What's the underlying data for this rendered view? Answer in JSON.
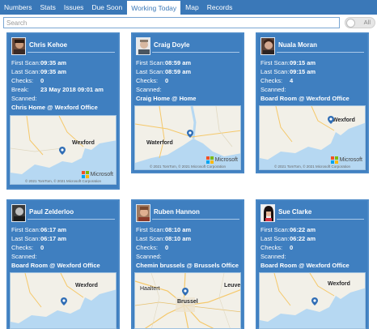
{
  "tabs": [
    {
      "label": "Numbers"
    },
    {
      "label": "Stats"
    },
    {
      "label": "Issues"
    },
    {
      "label": "Due Soon"
    },
    {
      "label": "Working Today",
      "active": true
    },
    {
      "label": "Map"
    },
    {
      "label": "Records"
    }
  ],
  "search": {
    "placeholder": "Search"
  },
  "toggle": {
    "label": "All"
  },
  "labels": {
    "first_scan": "First Scan:",
    "last_scan": "Last Scan:",
    "checks": "Checks:",
    "break": "Break:",
    "scanned": "Scanned:"
  },
  "cards": [
    {
      "name": "Chris Kehoe",
      "first_scan": "09:35 am",
      "last_scan": "09:35 am",
      "checks": "0",
      "break": "23 May 2018 09:01 am",
      "scanned": "Chris Home @ Wexford Office",
      "map_label": "Wexford",
      "map_label2": "",
      "brand": "Microsoft",
      "copyright": "© 2021 TomTom, © 2021 Microsoft Corporation"
    },
    {
      "name": "Craig Doyle",
      "first_scan": "08:59 am",
      "last_scan": "08:59 am",
      "checks": "0",
      "scanned": "Craig Home @ Home",
      "map_label": "Waterford",
      "map_label2": "",
      "brand": "Microsoft",
      "copyright": "© 2021 TomTom, © 2021 Microsoft Corporation"
    },
    {
      "name": "Nuala Moran",
      "first_scan": "09:15 am",
      "last_scan": "09:15 am",
      "checks": "4",
      "scanned": "Board Room @ Wexford Office",
      "map_label": "Wexford",
      "map_label2": "",
      "brand": "Microsoft",
      "copyright": "© 2021 TomTom, © 2021 Microsoft Corporation"
    },
    {
      "name": "Paul Zelderloo",
      "first_scan": "06:17 am",
      "last_scan": "06:17 am",
      "checks": "0",
      "scanned": "Board Room @ Wexford Office",
      "map_label": "Wexford",
      "map_label2": ""
    },
    {
      "name": "Ruben Hannon",
      "first_scan": "08:10 am",
      "last_scan": "08:10 am",
      "checks": "0",
      "scanned": "Chemin brussels @ Brussels Office",
      "map_label": "Brussel",
      "map_label2": "Leuve",
      "map_label3": "Haaltert"
    },
    {
      "name": "Sue Clarke",
      "first_scan": "06:22 am",
      "last_scan": "06:22 am",
      "checks": "0",
      "scanned": "Board Room @ Wexford Office",
      "map_label": "Wexford",
      "map_label2": ""
    }
  ],
  "colors": {
    "accent": "#3a78b8",
    "card": "#3f7fc0",
    "sea": "#b6d8f2",
    "land": "#f2f0e8",
    "road": "#f5c86a",
    "pin": "#2f6db5"
  }
}
